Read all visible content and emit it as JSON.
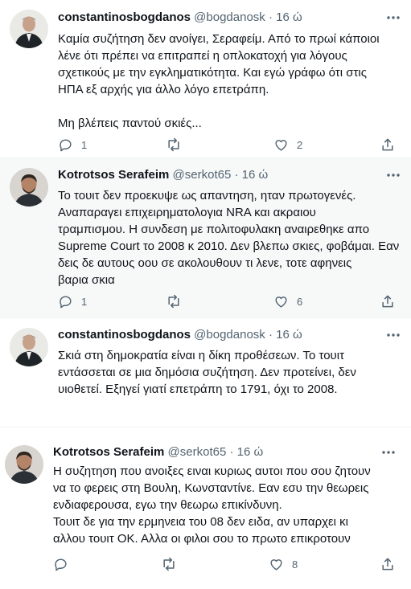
{
  "tweets": [
    {
      "name": "constantinosbogdanos",
      "handle": "@bogdanosk",
      "sep": "·",
      "time": "16 ώ",
      "text": "Καμία συζήτηση δεν ανοίγει, Σεραφείμ. Από το πρωί κάποιοι\nλένε ότι πρέπει να επιτραπεί η οπλοκατοχή για λόγους\nσχετικούς με την εγκληματικότητα. Και εγώ γράφω ότι στις\nΗΠΑ εξ αρχής για άλλο λόγο επετράπη.\n\nΜη βλέπεις παντού σκιές...",
      "reply_count": "1",
      "retweet_count": "",
      "like_count": "2"
    },
    {
      "name": "Kotrotsos Serafeim",
      "handle": "@serkot65",
      "sep": "·",
      "time": "16 ώ",
      "text": "Το τουιτ δεν προεκυψε ως απαντηση, ηταν πρωτογενές.\nΑναπαραγει επιχειρηματολογια NRA και ακραιου\nτραμπισμου. Η συνδεση με πολιτοφυλακη αναιρεθηκε απο\nSupreme Court το 2008 κ 2010. Δεν βλεπω σκιες, φοβάμαι. Εαν\nδεις δε αυτους οου σε ακολουθουν τι λενε, τοτε αφηνεις\nβαρια σκια",
      "reply_count": "1",
      "retweet_count": "",
      "like_count": "6"
    },
    {
      "name": "constantinosbogdanos",
      "handle": "@bogdanosk",
      "sep": "·",
      "time": "16 ώ",
      "text": "Σκιά στη δημοκρατία είναι η δίκη προθέσεων. Το τουιτ\nεντάσσεται σε μια δημόσια συζήτηση. Δεν προτείνει, δεν\nυιοθετεί. Εξηγεί γιατί επετράπη το 1791, όχι το 2008."
    },
    {
      "name": "Kotrotsos Serafeim",
      "handle": "@serkot65",
      "sep": "·",
      "time": "16 ώ",
      "text": "Η συζητηση που ανοιξες ειναι κυριως αυτοι που σου ζητουν\nνα το φερεις στη Βουλη, Κωνσταντίνε. Εαν εσυ την θεωρεις\nενδιαφερουσα, εγω την θεωρω επικίνδυνη.\nΤουιτ δε για την ερμηνεια του 08 δεν ειδα, αν υπαρχει κι\nαλλου τουιτ ΟΚ. Αλλα οι φιλοι σου το πρωτο επικροτουν",
      "reply_count": "",
      "retweet_count": "",
      "like_count": "8"
    }
  ],
  "icons": {
    "reply": "reply-icon",
    "retweet": "retweet-icon",
    "like": "like-icon",
    "share": "share-icon",
    "more": "more-icon"
  },
  "colors": {
    "text": "#0f1419",
    "secondary": "#536471",
    "highlight_bg": "#f7f9f9",
    "divider": "#eff3f4"
  }
}
